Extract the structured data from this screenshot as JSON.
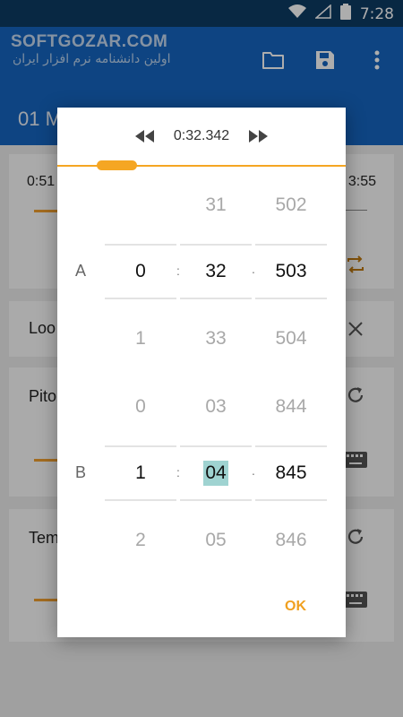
{
  "status_bar": {
    "time": "7:28",
    "icons": [
      "wifi-icon",
      "signal-icon",
      "battery-icon"
    ]
  },
  "watermark": {
    "title": "SOFTGOZAR.COM",
    "subtitle": "اولین دانشنامه نرم افزار ایران"
  },
  "app_bar": {
    "track_title": "01 M",
    "actions": [
      {
        "icon": "folder-icon"
      },
      {
        "icon": "save-icon"
      },
      {
        "icon": "more-vert-icon"
      }
    ]
  },
  "background": {
    "loop_card": {
      "start_time": "0:51",
      "end_time": "3:55"
    },
    "loop_label": "Loo",
    "pitch_label": "Pito",
    "tempo_label": "Tem"
  },
  "dialog": {
    "current_time": "0:32.342",
    "position_fraction": 0.12,
    "rows": {
      "a": {
        "label": "A",
        "above": [
          "",
          "31",
          "502"
        ],
        "selected": [
          "0",
          "32",
          "503"
        ],
        "below": [
          "1",
          "33",
          "504"
        ]
      },
      "b": {
        "label": "B",
        "above": [
          "0",
          "03",
          "844"
        ],
        "selected": [
          "1",
          "04",
          "845"
        ],
        "below": [
          "2",
          "05",
          "846"
        ]
      }
    },
    "separators": {
      "colon": ":",
      "dot": "."
    },
    "ok_label": "OK"
  },
  "colors": {
    "accent": "#f5a623",
    "primary": "#1565c0",
    "status_bar": "#0d3b64",
    "highlight": "#9fd3d1"
  }
}
